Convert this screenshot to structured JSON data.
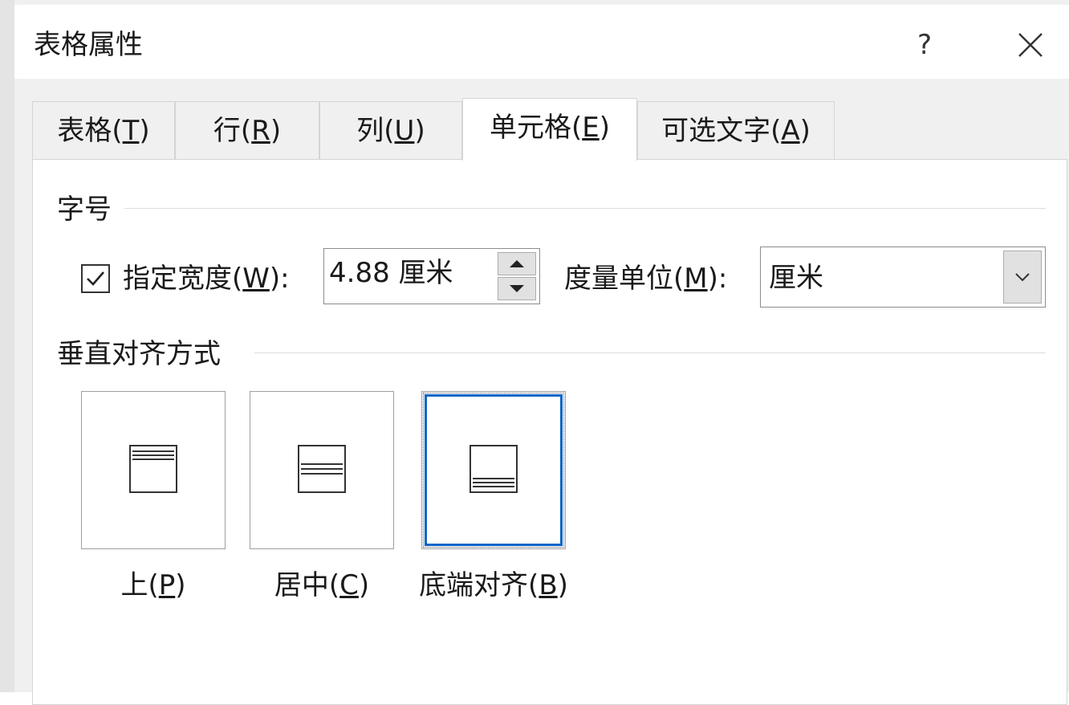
{
  "window": {
    "title": "表格属性",
    "help_label": "?",
    "close_icon": "close-icon"
  },
  "tabs": [
    {
      "label": "表格(",
      "mnemonic": "T",
      "suffix": ")",
      "active": false
    },
    {
      "label": "行(",
      "mnemonic": "R",
      "suffix": ")",
      "active": false
    },
    {
      "label": "列(",
      "mnemonic": "U",
      "suffix": ")",
      "active": false
    },
    {
      "label": "单元格(",
      "mnemonic": "E",
      "suffix": ")",
      "active": true
    },
    {
      "label": "可选文字(",
      "mnemonic": "A",
      "suffix": ")",
      "active": false
    }
  ],
  "size_group": {
    "title": "字号",
    "width_checkbox": {
      "checked": true,
      "label": "指定宽度(",
      "mnemonic": "W",
      "suffix": "):"
    },
    "width_value": "4.88 厘米",
    "unit": {
      "label": "度量单位(",
      "mnemonic": "M",
      "suffix": "):",
      "value": "厘米"
    }
  },
  "valign_group": {
    "title": "垂直对齐方式",
    "options": [
      {
        "label": "上(",
        "mnemonic": "P",
        "suffix": ")",
        "position": "top",
        "selected": false
      },
      {
        "label": "居中(",
        "mnemonic": "C",
        "suffix": ")",
        "position": "center",
        "selected": false
      },
      {
        "label": "底端对齐(",
        "mnemonic": "B",
        "suffix": ")",
        "position": "bottom",
        "selected": true
      }
    ]
  },
  "colors": {
    "focus": "#0a64c8",
    "panel_bg": "#ffffff",
    "window_bg": "#f0f0f0"
  }
}
